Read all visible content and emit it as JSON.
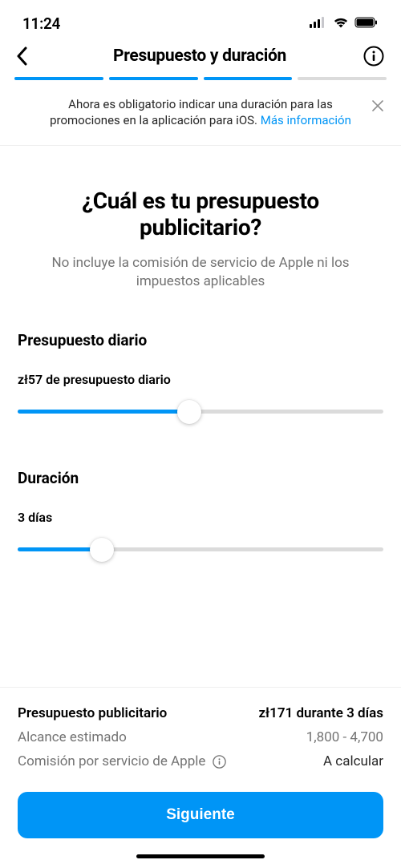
{
  "status": {
    "time": "11:24"
  },
  "header": {
    "title": "Presupuesto y duración"
  },
  "banner": {
    "text_prefix": "Ahora es obligatorio indicar una duración para las promociones en la aplicación para iOS. ",
    "link_text": "Más información"
  },
  "hero": {
    "title": "¿Cuál es tu presupuesto publicitario?",
    "subtitle": "No incluye la comisión de servicio de Apple ni los impuestos aplicables"
  },
  "budget": {
    "label": "Presupuesto diario",
    "value_text": "zł57 de presupuesto diario",
    "fill_percent": 47
  },
  "duration": {
    "label": "Duración",
    "value_text": "3 días",
    "fill_percent": 23
  },
  "summary": {
    "budget_label": "Presupuesto publicitario",
    "budget_value": "zł171 durante 3 días",
    "reach_label": "Alcance estimado",
    "reach_value": "1,800 - 4,700",
    "fee_label": "Comisión por servicio de Apple",
    "fee_value": "A calcular"
  },
  "cta": {
    "label": "Siguiente"
  },
  "colors": {
    "accent": "#0095f6"
  }
}
